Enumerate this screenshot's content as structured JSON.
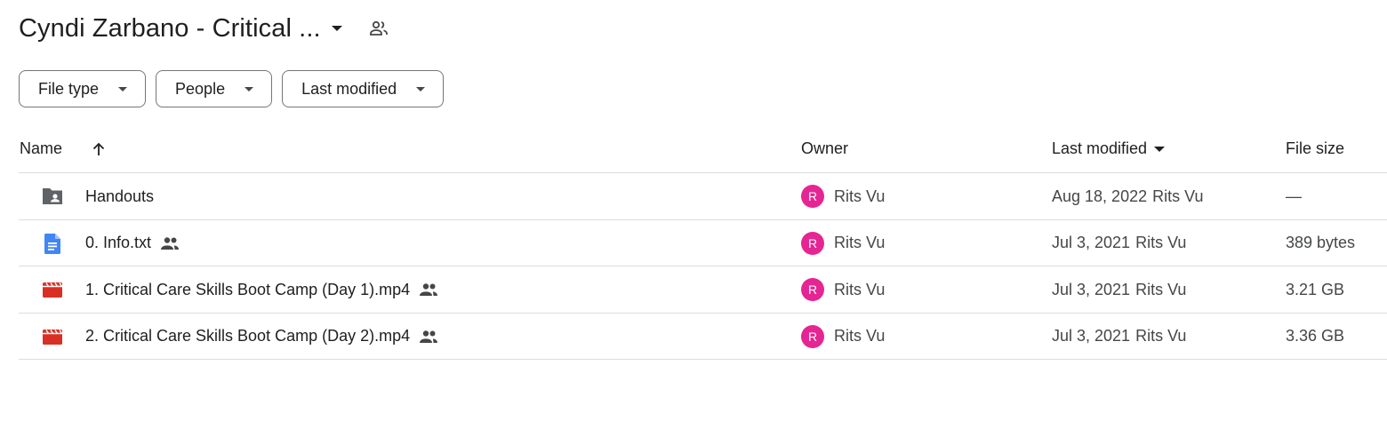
{
  "header": {
    "folder_title": "Cyndi Zarbano - Critical ...",
    "title_menu_icon": "arrow-drop-down-icon",
    "shared_icon": "people-outline-icon"
  },
  "filters": [
    {
      "label": "File type"
    },
    {
      "label": "People"
    },
    {
      "label": "Last modified"
    }
  ],
  "columns": {
    "name": "Name",
    "name_sort_icon": "arrow-upward-icon",
    "owner": "Owner",
    "last_modified": "Last modified",
    "file_size": "File size"
  },
  "files": [
    {
      "name": "Handouts",
      "icon": "shared-folder-icon",
      "shared": false,
      "owner_initial": "R",
      "owner": "Rits Vu",
      "modified_date": "Aug 18, 2022",
      "modified_by": "Rits Vu",
      "size": "—"
    },
    {
      "name": "0. Info.txt",
      "icon": "document-icon",
      "shared": true,
      "owner_initial": "R",
      "owner": "Rits Vu",
      "modified_date": "Jul 3, 2021",
      "modified_by": "Rits Vu",
      "size": "389 bytes"
    },
    {
      "name": "1. Critical Care Skills Boot Camp (Day 1).mp4",
      "icon": "video-icon",
      "shared": true,
      "owner_initial": "R",
      "owner": "Rits Vu",
      "modified_date": "Jul 3, 2021",
      "modified_by": "Rits Vu",
      "size": "3.21 GB"
    },
    {
      "name": "2. Critical Care Skills Boot Camp (Day 2).mp4",
      "icon": "video-icon",
      "shared": true,
      "owner_initial": "R",
      "owner": "Rits Vu",
      "modified_date": "Jul 3, 2021",
      "modified_by": "Rits Vu",
      "size": "3.36 GB"
    }
  ],
  "colors": {
    "folder": "#5f6368",
    "doc": "#4285f4",
    "video": "#d93025",
    "avatar": "#e52592"
  }
}
